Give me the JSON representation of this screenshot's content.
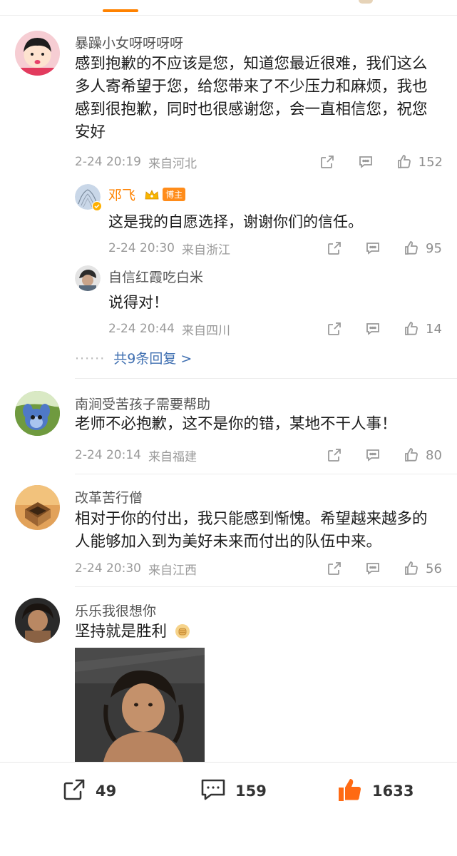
{
  "colors": {
    "accent": "#ff8200",
    "link": "#3f6fb1",
    "muted": "#9a9a9a",
    "like_active": "#ff6a13"
  },
  "comments": [
    {
      "username": "暴躁小女呀呀呀呀",
      "lines": [
        "感到抱歉的不应该是您，知道您最近很难，我们这么",
        "多人寄希望于您，给您带来了不少压力和麻烦，我也",
        "感到很抱歉，同时也很感谢您，会一直相信您，祝您",
        "安好"
      ],
      "time": "2-24 20:19",
      "location": "来自河北",
      "likes": "152",
      "replies": [
        {
          "username": "邓飞",
          "badge": "博主",
          "text": "这是我的自愿选择，谢谢你们的信任。",
          "time": "2-24 20:30",
          "location": "来自浙江",
          "likes": "95"
        },
        {
          "username": "自信红霞吃白米",
          "text": "说得对！",
          "time": "2-24 20:44",
          "location": "来自四川",
          "likes": "14"
        }
      ],
      "more_replies": "共9条回复 >"
    },
    {
      "username": "南涧受苦孩子需要帮助",
      "text": "老师不必抱歉，这不是你的错，某地不干人事！",
      "time": "2-24 20:14",
      "location": "来自福建",
      "likes": "80"
    },
    {
      "username": "改革苦行僧",
      "lines": [
        "相对于你的付出，我只能感到惭愧。希望越来越多的",
        "人能够加入到为美好未来而付出的队伍中来。"
      ],
      "time": "2-24 20:30",
      "location": "来自江西",
      "likes": "56"
    },
    {
      "username": "乐乐我很想你",
      "text": "坚持就是胜利",
      "emoji_icon": "fist-emoji-icon"
    }
  ],
  "toolbar": {
    "reposts": "49",
    "comments": "159",
    "likes": "1633"
  }
}
